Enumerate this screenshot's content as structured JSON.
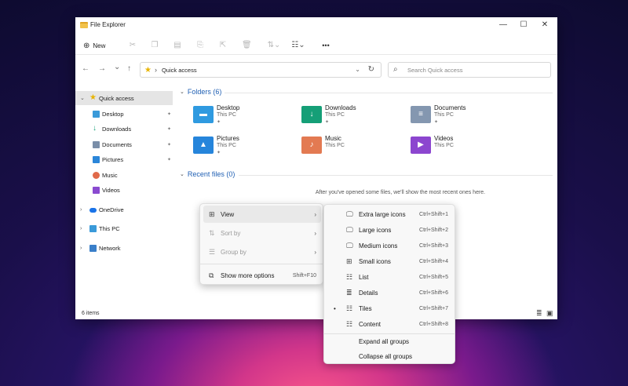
{
  "window": {
    "title": "File Explorer"
  },
  "titlebar_controls": {
    "minimize": "—",
    "maximize": "☐",
    "close": "✕"
  },
  "toolbar": {
    "new_label": "New",
    "new_icon": "⊕",
    "more_label": "•••",
    "icons": [
      "cut-icon",
      "copy-icon",
      "paste-icon",
      "rename-icon",
      "share-icon",
      "delete-icon",
      "sort-icon",
      "view-icon"
    ]
  },
  "address": {
    "back": "←",
    "forward": "→",
    "recent": "⌄",
    "up": "↑",
    "star": "★",
    "separator": "›",
    "path": "Quick access",
    "chevron": "⌄",
    "refresh": "↻"
  },
  "search": {
    "placeholder": "Search Quick access",
    "icon": "⌕"
  },
  "sidebar": {
    "quick_access": "Quick access",
    "pinned": [
      {
        "label": "Desktop",
        "pinned": true,
        "color": "#3a9ad9"
      },
      {
        "label": "Downloads",
        "pinned": true,
        "color": "#1aa37a"
      },
      {
        "label": "Documents",
        "pinned": true,
        "color": "#7a8ea8"
      },
      {
        "label": "Pictures",
        "pinned": true,
        "color": "#2b86d9"
      },
      {
        "label": "Music",
        "pinned": false,
        "color": "#e06a4a"
      },
      {
        "label": "Videos",
        "pinned": false,
        "color": "#8a4ad0"
      }
    ],
    "onedrive": "OneDrive",
    "this_pc": "This PC",
    "network": "Network",
    "chevron_open": "⌄",
    "chevron_closed": "›",
    "pin_glyph": "📌"
  },
  "folders_section": {
    "title": "Folders (6)",
    "chevron": "⌄"
  },
  "folders": [
    {
      "name": "Desktop",
      "sub": "This PC",
      "glyph": "▬",
      "color": "#2f9ae0"
    },
    {
      "name": "Downloads",
      "sub": "This PC",
      "glyph": "↓",
      "color": "#159f77"
    },
    {
      "name": "Documents",
      "sub": "This PC",
      "glyph": "≡",
      "color": "#8497b0"
    },
    {
      "name": "Pictures",
      "sub": "This PC",
      "glyph": "▲",
      "color": "#2685db"
    },
    {
      "name": "Music",
      "sub": "This PC",
      "glyph": "♪",
      "color": "#e37a52"
    },
    {
      "name": "Videos",
      "sub": "This PC",
      "glyph": "▶",
      "color": "#8c46cf"
    }
  ],
  "recent_section": {
    "title": "Recent files (0)",
    "chevron": "⌄",
    "empty_message": "After you've opened some files, we'll show the most recent ones here."
  },
  "status_bar": {
    "items": "6 items",
    "details_icon": "≣",
    "tiles_icon": "▣"
  },
  "context_menu": {
    "view": "View",
    "sort_by": "Sort by",
    "group_by": "Group by",
    "show_more": "Show more options",
    "show_more_shortcut": "Shift+F10",
    "arrow": "›",
    "view_icon": "⊞",
    "sort_icon": "⇅",
    "group_icon": "☰",
    "more_icon": "⧉"
  },
  "view_submenu": {
    "items": [
      {
        "label": "Extra large icons",
        "shortcut": "Ctrl+Shift+1",
        "icon": "🖵",
        "selected": false
      },
      {
        "label": "Large icons",
        "shortcut": "Ctrl+Shift+2",
        "icon": "🖵",
        "selected": false
      },
      {
        "label": "Medium icons",
        "shortcut": "Ctrl+Shift+3",
        "icon": "🖵",
        "selected": false
      },
      {
        "label": "Small icons",
        "shortcut": "Ctrl+Shift+4",
        "icon": "⊞",
        "selected": false
      },
      {
        "label": "List",
        "shortcut": "Ctrl+Shift+5",
        "icon": "☷",
        "selected": false
      },
      {
        "label": "Details",
        "shortcut": "Ctrl+Shift+6",
        "icon": "≣",
        "selected": false
      },
      {
        "label": "Tiles",
        "shortcut": "Ctrl+Shift+7",
        "icon": "☷",
        "selected": true
      },
      {
        "label": "Content",
        "shortcut": "Ctrl+Shift+8",
        "icon": "☷",
        "selected": false
      }
    ],
    "bullet": "•",
    "expand_all": "Expand all groups",
    "collapse_all": "Collapse all groups"
  }
}
